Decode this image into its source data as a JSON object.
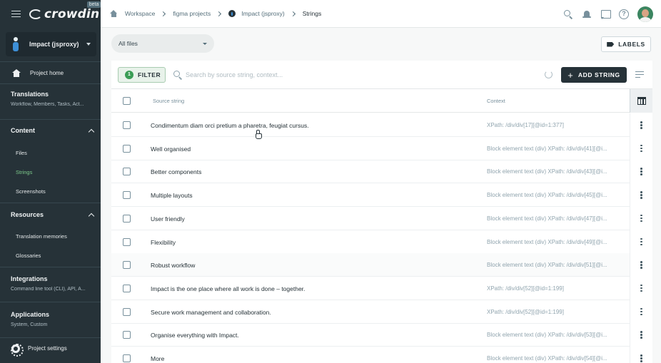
{
  "app": {
    "logo_text": "crowdin",
    "beta_label": "beta"
  },
  "sidebar": {
    "project_name": "Impact (jsproxy)",
    "home_label": "Project home",
    "translations": {
      "title": "Translations",
      "subtitle": "Workflow, Members, Tasks, Act..."
    },
    "content": {
      "title": "Content",
      "items": [
        "Files",
        "Strings",
        "Screenshots"
      ],
      "active": "Strings"
    },
    "resources": {
      "title": "Resources",
      "items": [
        "Translation memories",
        "Glossaries"
      ]
    },
    "integrations": {
      "title": "Integrations",
      "subtitle": "Command line tool (CLI), API, A..."
    },
    "applications": {
      "title": "Applications",
      "subtitle": "System, Custom"
    },
    "settings_label": "Project settings"
  },
  "breadcrumb": [
    "Workspace",
    "figma projects",
    "Impact (jsproxy)",
    "Strings"
  ],
  "toolbar": {
    "files_select": "All files",
    "labels_button": "LABELS",
    "filter_count": "1",
    "filter_button": "FILTER",
    "search_placeholder": "Search by source string, context...",
    "add_button": "ADD STRING"
  },
  "table": {
    "headers": {
      "source": "Source string",
      "context": "Context"
    },
    "rows": [
      {
        "source": "Condimentum diam orci pretium a pharetra, feugiat cursus.",
        "context": "XPath: /div/div[17][@id=1:377]"
      },
      {
        "source": "Well organised",
        "context": "Block element text (div) XPath: /div/div[41][@i..."
      },
      {
        "source": "Better components",
        "context": "Block element text (div) XPath: /div/div[43][@i..."
      },
      {
        "source": "Multiple layouts",
        "context": "Block element text (div) XPath: /div/div[45][@i..."
      },
      {
        "source": "User friendly",
        "context": "Block element text (div) XPath: /div/div[47][@i..."
      },
      {
        "source": "Flexibility",
        "context": "Block element text (div) XPath: /div/div[49][@i..."
      },
      {
        "source": "Robust workflow",
        "context": "Block element text (div) XPath: /div/div[51][@i..."
      },
      {
        "source": "Impact is the one place where all work is done – together.",
        "context": "XPath: /div/div[52][@id=1:199]"
      },
      {
        "source": "Secure work management and collaboration.",
        "context": "XPath: /div/div[52][@id=1:199]"
      },
      {
        "source": "Organise everything with Impact.",
        "context": "Block element text (div) XPath: /div/div[53][@i..."
      },
      {
        "source": "More",
        "context": "Block element text (div) XPath: /div/div[54][@i..."
      }
    ]
  },
  "colors": {
    "sidebar_bg": "#263238",
    "accent_green": "#3a9d55",
    "active_link": "#7cc88a"
  }
}
